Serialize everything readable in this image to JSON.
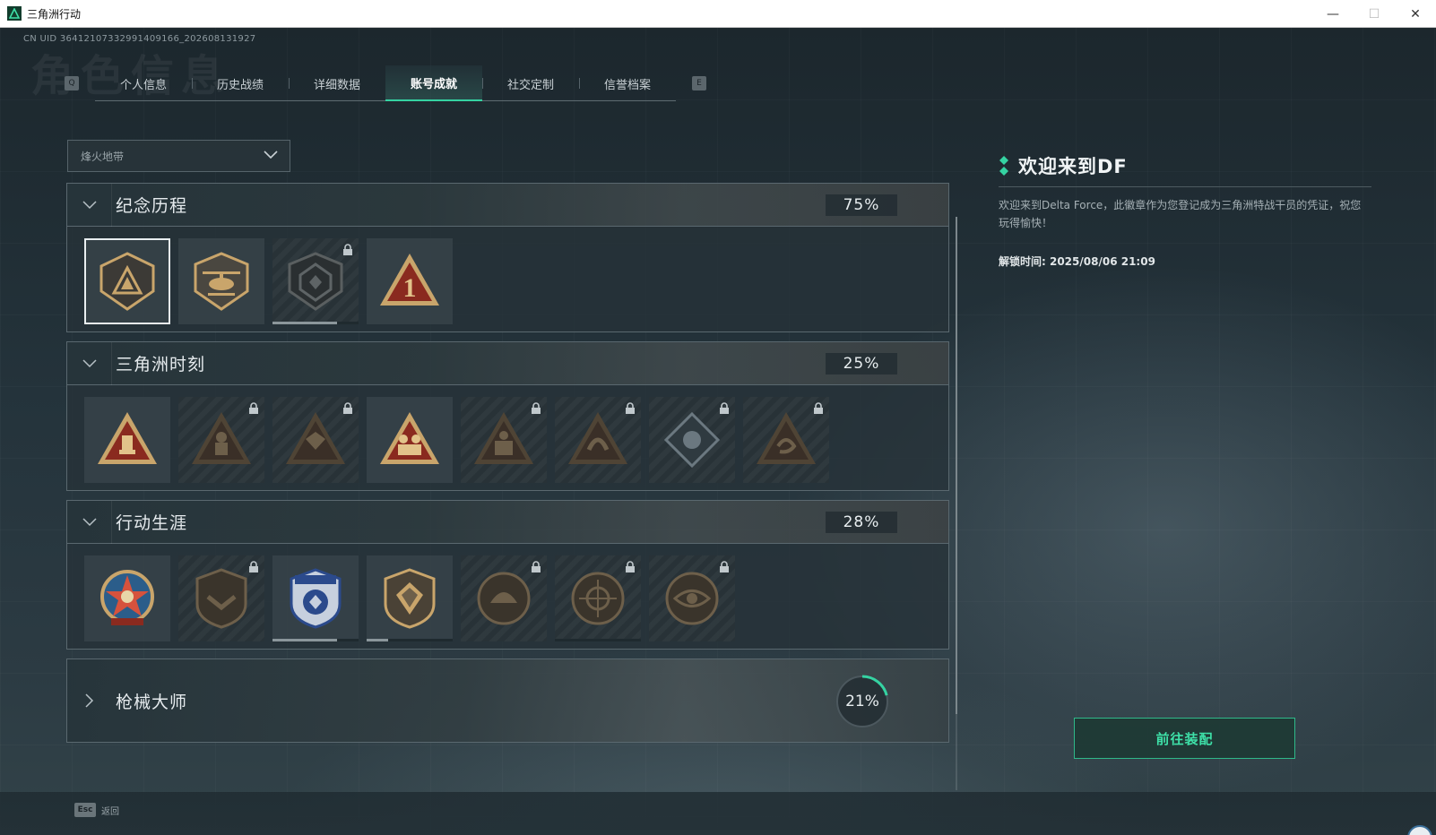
{
  "window": {
    "title": "三角洲行动",
    "controls": [
      "—",
      "☐",
      "✕"
    ]
  },
  "header": {
    "uid": "CN UID 3641210733299140916",
    "uid_suffix": "6_202608131927",
    "page_title_bg": "角色信息",
    "key_left": "Q",
    "key_right": "E"
  },
  "tabs": [
    {
      "label": "个人信息",
      "active": false
    },
    {
      "label": "历史战绩",
      "active": false
    },
    {
      "label": "详细数据",
      "active": false
    },
    {
      "label": "账号成就",
      "active": true
    },
    {
      "label": "社交定制",
      "active": false
    },
    {
      "label": "信誉档案",
      "active": false
    }
  ],
  "filter": {
    "selected": "烽火地带"
  },
  "sections": [
    {
      "title": "纪念历程",
      "percent": "75%",
      "badges": [
        {
          "icon": "triangle-shield-badge",
          "locked": false,
          "selected": true
        },
        {
          "icon": "helicopter-shield-badge",
          "locked": false
        },
        {
          "icon": "dark-hex-badge",
          "locked": true,
          "progress": 0.75
        },
        {
          "icon": "number-one-triangle-badge",
          "locked": false
        }
      ]
    },
    {
      "title": "三角洲时刻",
      "percent": "25%",
      "badges": [
        {
          "icon": "fire-triangle-badge",
          "locked": false
        },
        {
          "icon": "figure-triangle-badge",
          "locked": true
        },
        {
          "icon": "crest-triangle-badge",
          "locked": true
        },
        {
          "icon": "squad-triangle-badge",
          "locked": false
        },
        {
          "icon": "soldiers-triangle-badge",
          "locked": true
        },
        {
          "icon": "serpent-triangle-badge",
          "locked": true
        },
        {
          "icon": "rose-diamond-badge",
          "locked": true
        },
        {
          "icon": "dragon-triangle-badge",
          "locked": true
        }
      ]
    },
    {
      "title": "行动生涯",
      "percent": "28%",
      "badges": [
        {
          "icon": "star-medal-badge",
          "locked": false
        },
        {
          "icon": "chevron-shield-badge",
          "locked": true
        },
        {
          "icon": "blue-eagle-shield-badge",
          "locked": false,
          "progress": 0.75
        },
        {
          "icon": "gem-shield-badge",
          "locked": false,
          "progress": 0.25
        },
        {
          "icon": "helmet-round-badge",
          "locked": true
        },
        {
          "icon": "crosshair-round-badge",
          "locked": true
        },
        {
          "icon": "eye-round-badge",
          "locked": true
        }
      ]
    }
  ],
  "gun_section": {
    "title": "枪械大师",
    "percent": "21%",
    "progress": 0.21
  },
  "info_panel": {
    "title": "欢迎来到DF",
    "description": "欢迎来到Delta Force，此徽章作为您登记成为三角洲特战干员的凭证，祝您玩得愉快！",
    "unlock_label": "解锁时间: 2025/08/06 21:09"
  },
  "equip_button": "前往装配",
  "back": {
    "key": "Esc",
    "label": "返回"
  },
  "colors": {
    "accent": "#35d3a2",
    "button_text": "#3ee0a8",
    "badge_gold": "#c9a56b",
    "badge_red": "#8a2a1f"
  }
}
